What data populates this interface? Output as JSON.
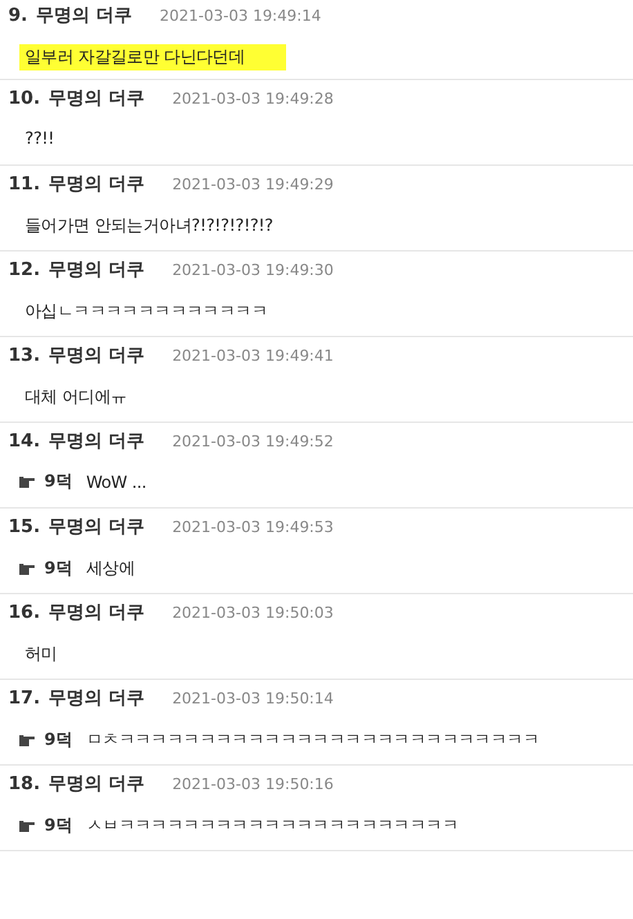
{
  "comments": [
    {
      "number": "9.",
      "author": "무명의 더쿠",
      "time": "2021-03-03 19:49:14",
      "text": "일부러 자갈길로만 다닌다던데",
      "highlighted": true
    },
    {
      "number": "10.",
      "author": "무명의 더쿠",
      "time": "2021-03-03 19:49:28",
      "text": "??!!",
      "highlighted": false
    },
    {
      "number": "11.",
      "author": "무명의 더쿠",
      "time": "2021-03-03 19:49:29",
      "text": "들어가면 안되는거아녀?!?!?!?!?!?",
      "highlighted": false
    },
    {
      "number": "12.",
      "author": "무명의 더쿠",
      "time": "2021-03-03 19:49:30",
      "text": "아십ㄴㅋㅋㅋㅋㅋㅋㅋㅋㅋㅋㅋㅋ",
      "highlighted": false
    },
    {
      "number": "13.",
      "author": "무명의 더쿠",
      "time": "2021-03-03 19:49:41",
      "text": "대체 어디에ㅠ",
      "highlighted": false
    },
    {
      "number": "14.",
      "author": "무명의 더쿠",
      "time": "2021-03-03 19:49:52",
      "reply_to": "9덕",
      "text": "WoW ...",
      "highlighted": false
    },
    {
      "number": "15.",
      "author": "무명의 더쿠",
      "time": "2021-03-03 19:49:53",
      "reply_to": "9덕",
      "text": "세상에",
      "highlighted": false
    },
    {
      "number": "16.",
      "author": "무명의 더쿠",
      "time": "2021-03-03 19:50:03",
      "text": "허미",
      "highlighted": false
    },
    {
      "number": "17.",
      "author": "무명의 더쿠",
      "time": "2021-03-03 19:50:14",
      "reply_to": "9덕",
      "text": "ㅁㅊㅋㅋㅋㅋㅋㅋㅋㅋㅋㅋㅋㅋㅋㅋㅋㅋㅋㅋㅋㅋㅋㅋㅋㅋㅋㅋ",
      "highlighted": false
    },
    {
      "number": "18.",
      "author": "무명의 더쿠",
      "time": "2021-03-03 19:50:16",
      "reply_to": "9덕",
      "text": "ㅅㅂㅋㅋㅋㅋㅋㅋㅋㅋㅋㅋㅋㅋㅋㅋㅋㅋㅋㅋㅋㅋㅋ",
      "highlighted": false
    }
  ]
}
